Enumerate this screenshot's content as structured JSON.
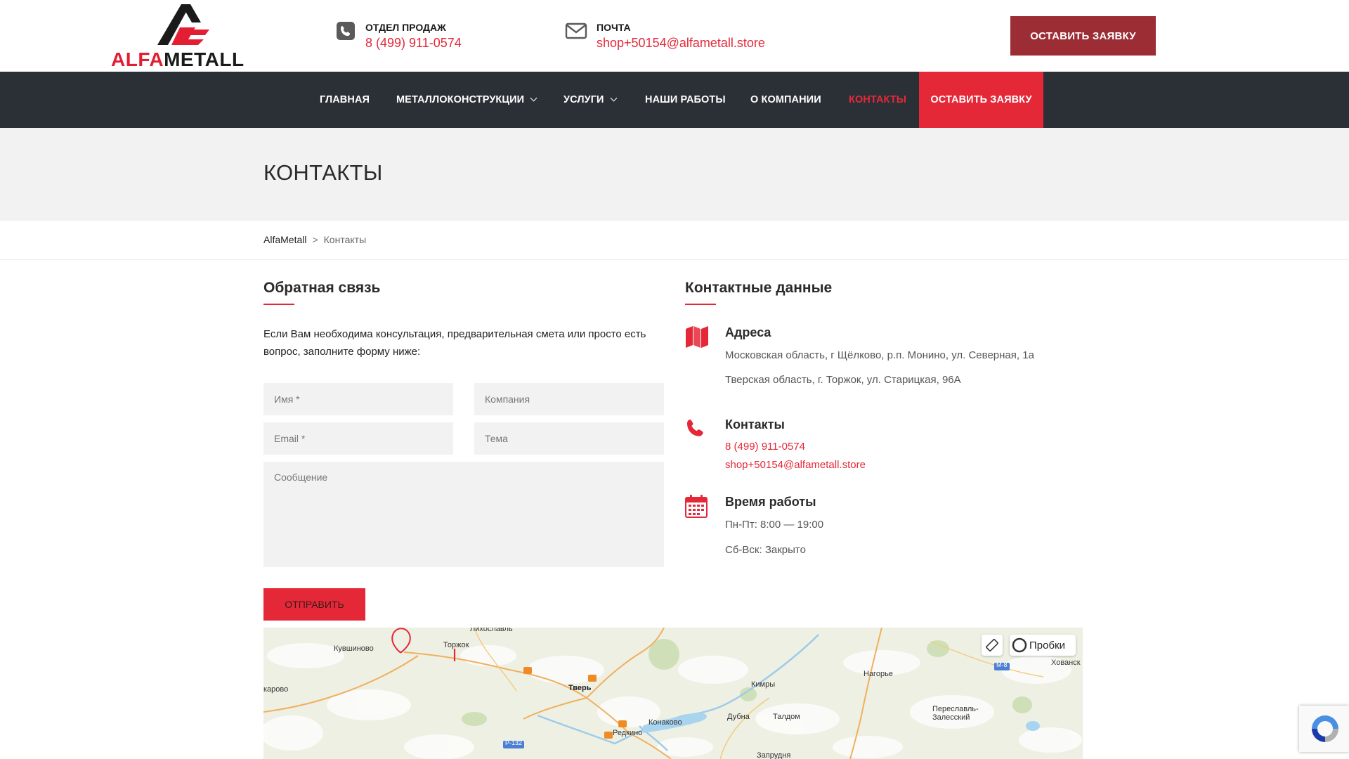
{
  "header": {
    "logo_text_a": "ALFA",
    "logo_text_b": "METALL",
    "sales_label": "ОТДЕЛ ПРОДАЖ",
    "sales_phone": "8 (499) 911-0574",
    "mail_label": "ПОЧТА",
    "mail_value": "shop+50154@alfametall.store",
    "cta": "ОСТАВИТЬ ЗАЯВКУ",
    "icons": [
      "phone-icon",
      "mail-icon"
    ]
  },
  "nav": {
    "items": [
      {
        "label": "ГЛАВНАЯ"
      },
      {
        "label": "МЕТАЛЛОКОНСТРУКЦИИ"
      },
      {
        "label": "УСЛУГИ"
      },
      {
        "label": "НАШИ РАБОТЫ"
      },
      {
        "label": "О КОМПАНИИ"
      },
      {
        "label": "КОНТАКТЫ"
      },
      {
        "label": "ОСТАВИТЬ ЗАЯВКУ"
      }
    ]
  },
  "page": {
    "title": "КОНТАКТЫ",
    "breadcrumb": {
      "home": "AlfaMetall",
      "sep": ">",
      "current": "Контакты"
    }
  },
  "form": {
    "title": "Обратная связь",
    "intro": "Если Вам необходима консультация, предварительная смета или просто есть вопрос, заполните форму ниже:",
    "name_placeholder": "Имя *",
    "company_placeholder": "Компания",
    "email_placeholder": "Email *",
    "subject_placeholder": "Тема",
    "message_placeholder": "Сообщение",
    "submit": "ОТПРАВИТЬ"
  },
  "contacts": {
    "title": "Контактные данные",
    "addresses_head": "Адреса",
    "address_1": "Московская область,  г Щёлково, р.п. Монино, ул. Северная, 1а",
    "address_2": "Тверская область, г. Торжок, ул. Старицкая, 96А",
    "contacts_head": "Контакты",
    "phone": "8 (499) 911-0574",
    "email": "shop+50154@alfametall.store",
    "hours_head": "Время работы",
    "hours_1": "Пн-Пт: 8:00 — 19:00",
    "hours_2": "Сб-Вск: Закрыто",
    "accent_color": "#e52838"
  },
  "map": {
    "traffic_label": "Пробки",
    "places": [
      "Лихославль",
      "Кувшиново",
      "Торжок",
      "карово",
      "Тверь",
      "Кимры",
      "Нагорье",
      "Хованск",
      "Дубна",
      "Талдом",
      "Конаково",
      "Редкино",
      "Переславль-Залесский",
      "Запрудня"
    ],
    "roads": [
      "Р-132",
      "М-8"
    ]
  }
}
